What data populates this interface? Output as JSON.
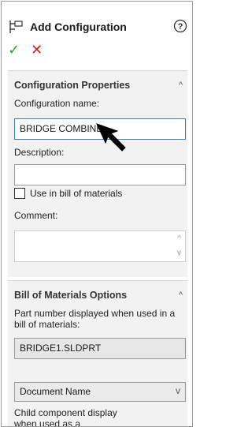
{
  "header": {
    "title": "Add Configuration",
    "help": "?"
  },
  "actions": {
    "ok": "✓",
    "cancel": "✕"
  },
  "config_props": {
    "title": "Configuration Properties",
    "name_label": "Configuration name:",
    "name_value": "BRIDGE COMBINE",
    "description_label": "Description:",
    "description_value": "",
    "use_bom_label": "Use in bill of materials",
    "comment_label": "Comment:",
    "comment_value": ""
  },
  "bom_options": {
    "title": "Bill of Materials Options",
    "part_number_label": "Part number displayed when used in a bill of materials:",
    "part_number_value": "BRIDGE1.SLDPRT",
    "source_selected": "Document Name",
    "child_display_label": "Child component display when used as a subassembly:"
  },
  "icons": {
    "config": "add-configuration-icon",
    "help": "help-icon",
    "ok": "check-icon",
    "cancel": "close-icon",
    "collapse": "chevron-up-icon",
    "dropdown": "chevron-down-icon",
    "cursor": "mouse-pointer-icon"
  }
}
